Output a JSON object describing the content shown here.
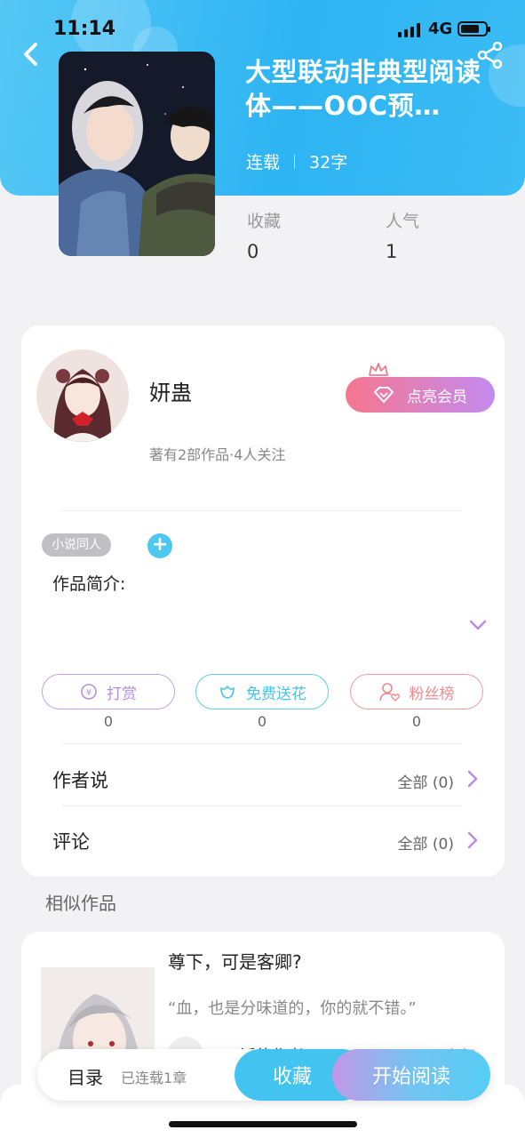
{
  "status_bar": {
    "time": "11:14",
    "network": "4G"
  },
  "book": {
    "title": "大型联动非典型阅读体——OOC预…",
    "status": "连载",
    "word_count": "32字",
    "stats": [
      {
        "label": "收藏",
        "value": "0"
      },
      {
        "label": "人气",
        "value": "1"
      }
    ]
  },
  "author": {
    "name": "妍蛊",
    "summary": "著有2部作品·4人关注",
    "vip_button": "点亮会员",
    "tag": "小说同人",
    "intro_label": "作品简介:"
  },
  "actions": [
    {
      "label": "打赏",
      "count": "0",
      "color": "#b78ce0"
    },
    {
      "label": "免费送花",
      "count": "0",
      "color": "#44c4ea"
    },
    {
      "label": "粉丝榜",
      "count": "0",
      "color": "#ee8a90"
    }
  ],
  "rows": [
    {
      "label": "作者说",
      "value": "全部 (0)"
    },
    {
      "label": "评论",
      "value": "全部 (0)"
    }
  ],
  "similar": {
    "section_label": "相似作品",
    "items": [
      {
        "title": "尊下，可是客卿?",
        "desc": "“血，也是分味道的，你的就不错。”",
        "author": "只活的作者",
        "heat": "5321人气"
      }
    ]
  },
  "bottom_bar": {
    "toc_label": "目录",
    "toc_status": "已连载1章",
    "collect_label": "收藏",
    "read_label": "开始阅读"
  },
  "colors": {
    "header": "#2eb4f3",
    "vip_start": "#f6768f",
    "vip_end": "#c38bf0"
  }
}
